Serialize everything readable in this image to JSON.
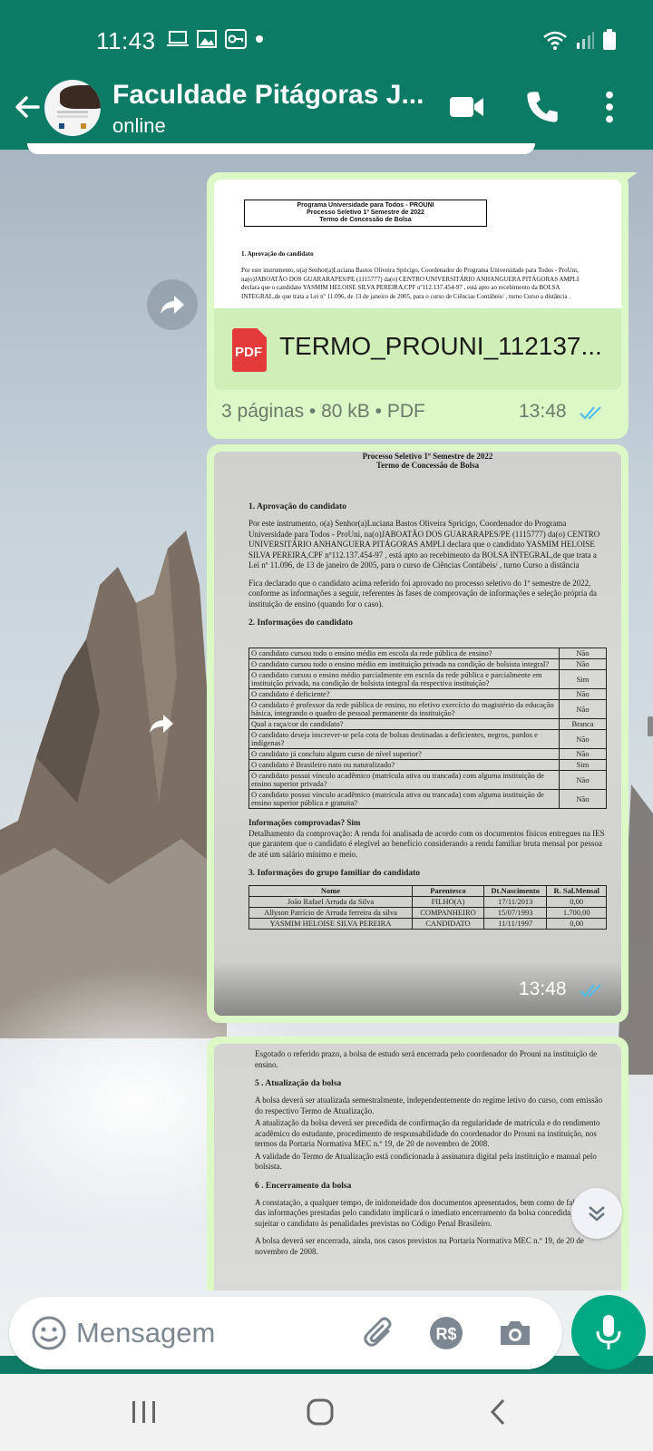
{
  "status_bar": {
    "time": "11:43"
  },
  "header": {
    "title": "Faculdade Pitágoras J...",
    "subtitle": "online"
  },
  "pdf_preview": {
    "heading_lines": [
      "Programa Universidade para Todos - PROUNI",
      "Processo Seletivo 1º Semestre de 2022",
      "Termo de Concessão de Bolsa"
    ],
    "section": "1. Aprovação do candidato",
    "paragraph": "Por este instrumento, o(a) Senhor(a)Luciana Bastos Oliveira Spricigo, Coordenador do Programa Universidade para Todos - ProUni, na(o)JABOATÃO DOS GUARARAPES/PE (1115777) da(o) CENTRO UNIVERSITÁRIO ANHANGUERA PITÁGORAS AMPLI declara que o candidato YASMIM HELOISE SILVA PEREIRA,CPF nº112.137.454-97 , está apto ao recebimento da BOLSA INTEGRAL,de que trata a Lei nº 11.096, de 13 de janeiro de 2005, para o curso de Ciências Contábeis/ , turno Curso a distância ."
  },
  "file_message": {
    "file_name": "TERMO_PROUNI_112137...",
    "file_icon_label": "PDF",
    "meta": "3 páginas • 80 kB • PDF",
    "time": "13:48"
  },
  "photo_message_1": {
    "heading_lines": [
      "Processo Seletivo 1º Semestre de 2022",
      "Termo de Concessão de Bolsa"
    ],
    "section1": "1. Aprovação do candidato",
    "para1": "Por este instrumento, o(a) Senhor(a)Luciana Bastos Oliveira Spricigo, Coordenador do Programa Universidade para Todos - ProUni, na(o)JABOATÃO DOS GUARARAPES/PE (1115777) da(o) CENTRO UNIVERSITÁRIO ANHANGUERA PITÁGORAS AMPLI declara que o candidato YASMIM HELOISE SILVA PEREIRA,CPF nº112.137.454-97 , está apto ao recebimento da BOLSA INTEGRAL,de que trata a Lei nº 11.096, de 13 de janeiro de 2005, para o curso de Ciências Contábeis/ , turno Curso a distância",
    "para2": "Fica declarado que o candidato acima referido foi aprovado no processo seletivo do 1º semestre de 2022, conforme as informações a seguir, referentes às fases de comprovação de informações e seleção própria da instituição de ensino (quando for o caso).",
    "section2": "2. Informações do candidato",
    "rows": [
      {
        "q": "O candidato cursou todo o ensino médio em escola da rede pública de ensino?",
        "a": "Não"
      },
      {
        "q": "O candidato cursou todo o ensino médio em instituição privada na condição de bolsista integral?",
        "a": "Não"
      },
      {
        "q": "O candidato cursou o ensino médio parcialmente em escola da rede pública e parcialmente em instituição privada, na condição de bolsista integral da respectiva instituição?",
        "a": "Sim"
      },
      {
        "q": "O candidato é deficiente?",
        "a": "Não"
      },
      {
        "q": "O candidato é professor da rede pública de ensino, no efetivo exercício do magistério da educação básica, integrando o quadro de pessoal permanente da instituição?",
        "a": "Não"
      },
      {
        "q": "Qual a raça/cor do candidato?",
        "a": "Branca"
      },
      {
        "q": "O candidato deseja inscrever-se pela cota de bolsas destinadas a deficientes, negros, pardos e indígenas?",
        "a": "Não"
      },
      {
        "q": "O candidato já concluiu algum curso de nível superior?",
        "a": "Não"
      },
      {
        "q": "O candidato é Brasileiro nato ou naturalizado?",
        "a": "Sim"
      },
      {
        "q": "O candidato possui vínculo acadêmico (matrícula ativa ou trancada) com alguma instituição de ensino superior privada?",
        "a": "Não"
      },
      {
        "q": "O candidato possui vínculo acadêmico (matrícula ativa ou trancada) com alguma instituição de ensino superior pública e gratuita?",
        "a": "Não"
      }
    ],
    "info_line": "Informações comprovadas? Sim",
    "detail": "Detalhamento da comprovação: A renda foi analisada de acordo com os documentos físicos entregues na IES que garantem que o candidato é elegível ao benefício considerando a renda familiar bruta mensal por pessoa de até um salário mínimo e meio.",
    "section3": "3. Informações do grupo familiar do candidato",
    "family_header": [
      "Nome",
      "Parentesco",
      "Dt.Nascimento",
      "R. Sal.Mensal"
    ],
    "family": [
      [
        "João Rafael Arruda da Silva",
        "FILHO(A)",
        "17/11/2013",
        "0,00"
      ],
      [
        "Allyson Patrício de Arruda ferreira da silva",
        "COMPANHEIRO",
        "15/07/1993",
        "1.700,00"
      ],
      [
        "YASMIM HELOISE SILVA PEREIRA",
        "CANDIDATO",
        "11/11/1997",
        "0,00"
      ]
    ],
    "time": "13:48"
  },
  "photo_message_2": {
    "p1": "Esgotado o referido prazo, a bolsa de estudo será encerrada pelo coordenador do Prouni na instituição de ensino.",
    "section5": "5 . Atualização da bolsa",
    "p2": "A bolsa deverá ser atualizada semestralmente, independentemente do regime letivo do curso, com emissão do respectivo Termo de Atualização.",
    "p3": "A atualização da bolsa deverá ser precedida de confirmação da regularidade de matrícula e do rendimento acadêmico do estudante, procedimento de responsabilidade do coordenador do Prouni na instituição, nos termos da Portaria Normativa MEC n.º 19, de 20 de novembro de 2008.",
    "p4": "A validade do Termo de Atualização está condicionada à assinatura digital pela instituição e manual pelo bolsista.",
    "section6": "6 . Encerramento da bolsa",
    "p5": "A constatação, a qualquer tempo, de inidoneidade dos documentos apresentados, bem como de falsidade das informações prestadas pelo candidato implicará o imediato encerramento da bolsa concedida, além de sujeitar o candidato às penalidades previstas no Código Penal Brasileiro.",
    "p6": "A bolsa deverá ser encerrada, ainda, nos casos previstos na Portaria Normativa MEC n.º 19, de 20 de novembro de 2008."
  },
  "composer": {
    "placeholder": "Mensagem"
  },
  "colors": {
    "header": "#0b7b65",
    "bubble": "#dcf8c6",
    "mic": "#00a884",
    "ticks": "#53bdeb"
  }
}
